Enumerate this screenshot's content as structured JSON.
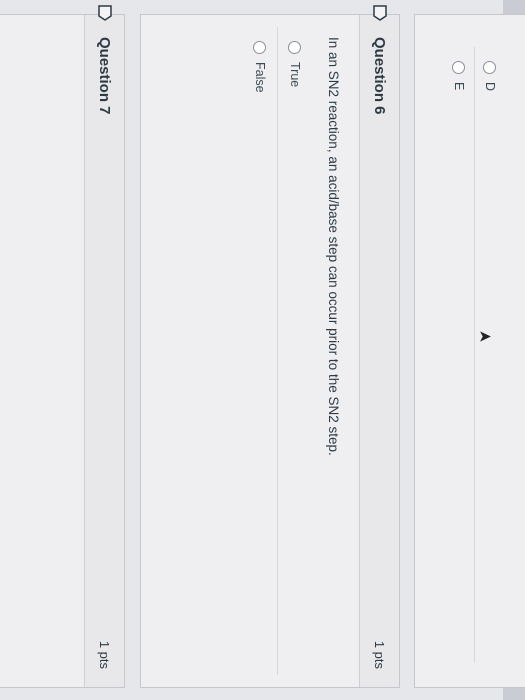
{
  "prev_question": {
    "options": [
      {
        "label": "D"
      },
      {
        "label": "E"
      }
    ]
  },
  "question6": {
    "title": "Question 6",
    "points": "1 pts",
    "prompt": "In an SN2 reaction, an acid/base step can occur prior to the SN2 step.",
    "options": [
      {
        "label": "True"
      },
      {
        "label": "False"
      }
    ]
  },
  "question7": {
    "title": "Question 7",
    "points": "1 pts"
  },
  "colors": {
    "text": "#2d3b45",
    "card_header": "#e8e8eb",
    "border": "#c5c7cc",
    "flag_outline": "#2d3b45"
  }
}
